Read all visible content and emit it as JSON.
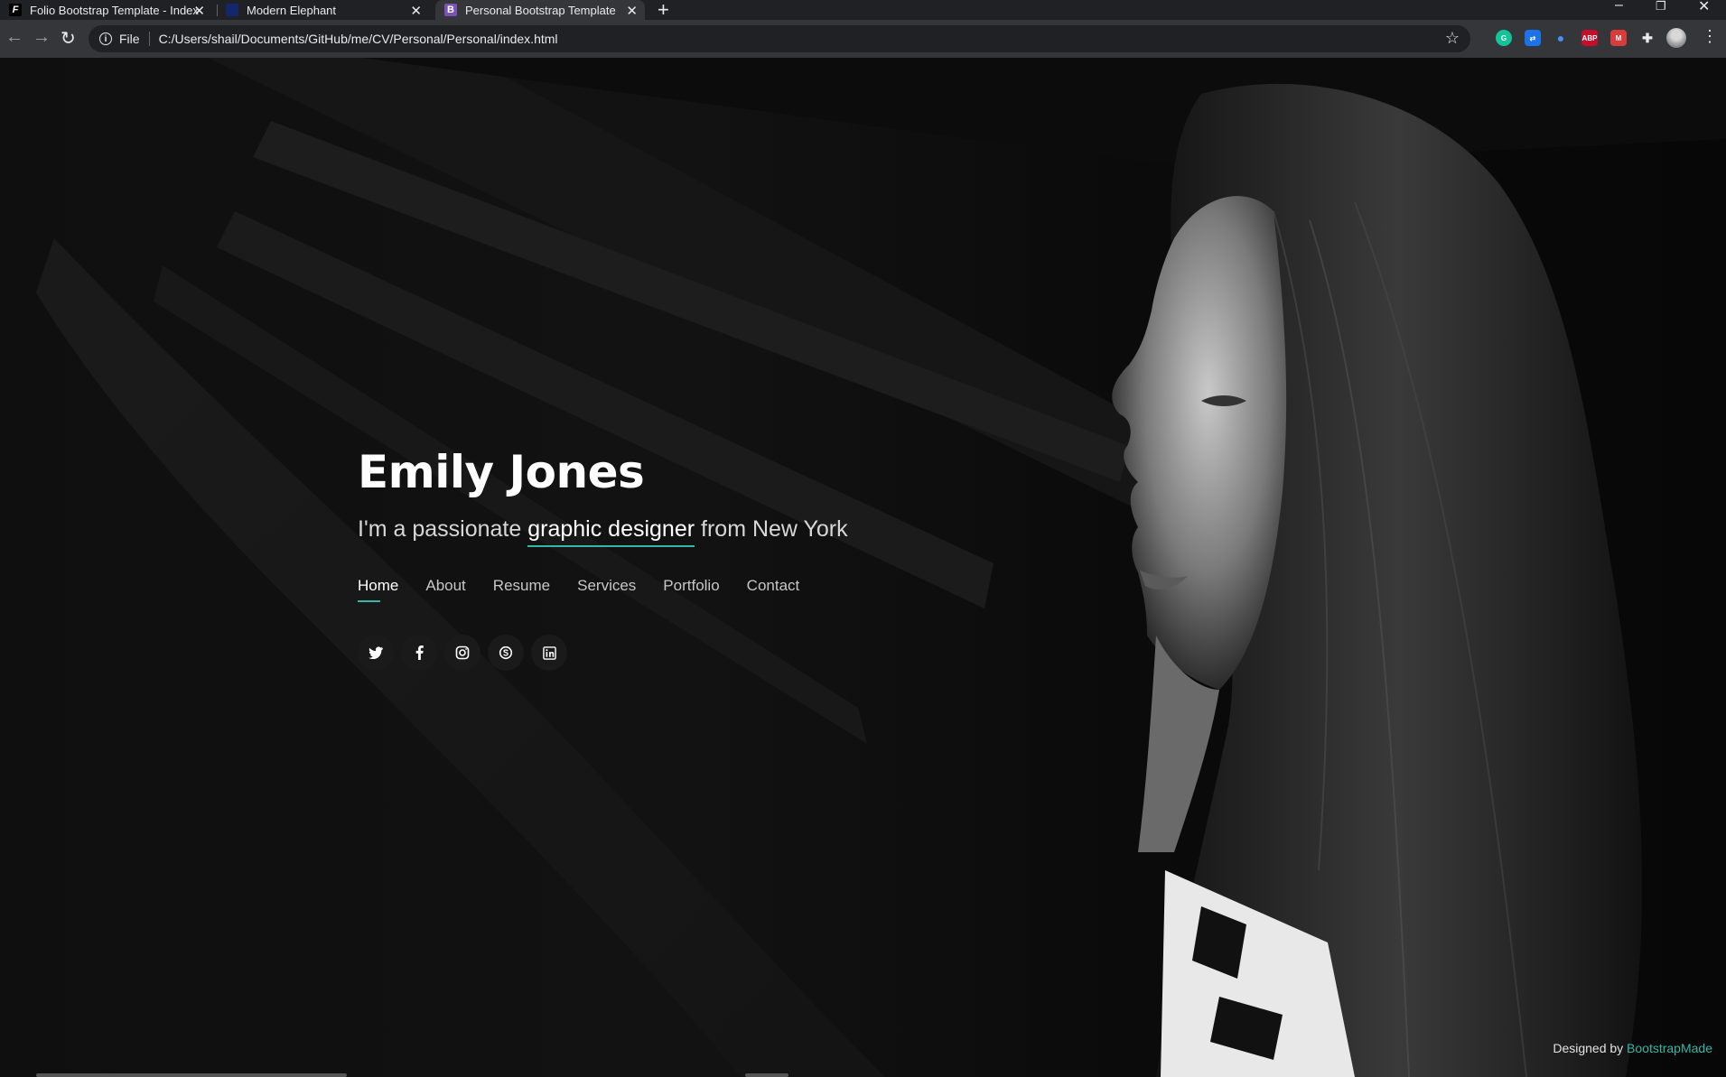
{
  "browser": {
    "tabs": [
      {
        "title": "Folio Bootstrap Template - Index",
        "favicon": "F",
        "active": false
      },
      {
        "title": "Modern Elephant",
        "favicon": "",
        "active": false
      },
      {
        "title": "Personal Bootstrap Template",
        "favicon": "B",
        "active": true
      }
    ],
    "new_tab": "+",
    "close_glyph": "✕",
    "omnibox": {
      "info": "i",
      "chip": "File",
      "url": "C:/Users/shail/Documents/GitHub/me/CV/Personal/Personal/index.html"
    },
    "extensions": [
      "grammarly-icon",
      "translate-icon",
      "drop-icon",
      "adblock-icon",
      "red-ext-icon",
      "puzzle-icon"
    ],
    "abp_label": "ABP"
  },
  "hero": {
    "name": "Emily Jones",
    "subtitle_prefix": "I'm a passionate",
    "subtitle_typed": "graphic designer",
    "subtitle_suffix": "from New York"
  },
  "nav": {
    "items": [
      "Home",
      "About",
      "Resume",
      "Services",
      "Portfolio",
      "Contact"
    ],
    "active": "Home"
  },
  "social": [
    "twitter-icon",
    "facebook-icon",
    "instagram-icon",
    "skype-icon",
    "linkedin-icon"
  ],
  "footer": {
    "credits_prefix": "Designed by",
    "credits_link": "BootstrapMade"
  },
  "colors": {
    "accent": "#34b7a7",
    "background": "#0f0f0f",
    "text": "#ffffff"
  }
}
